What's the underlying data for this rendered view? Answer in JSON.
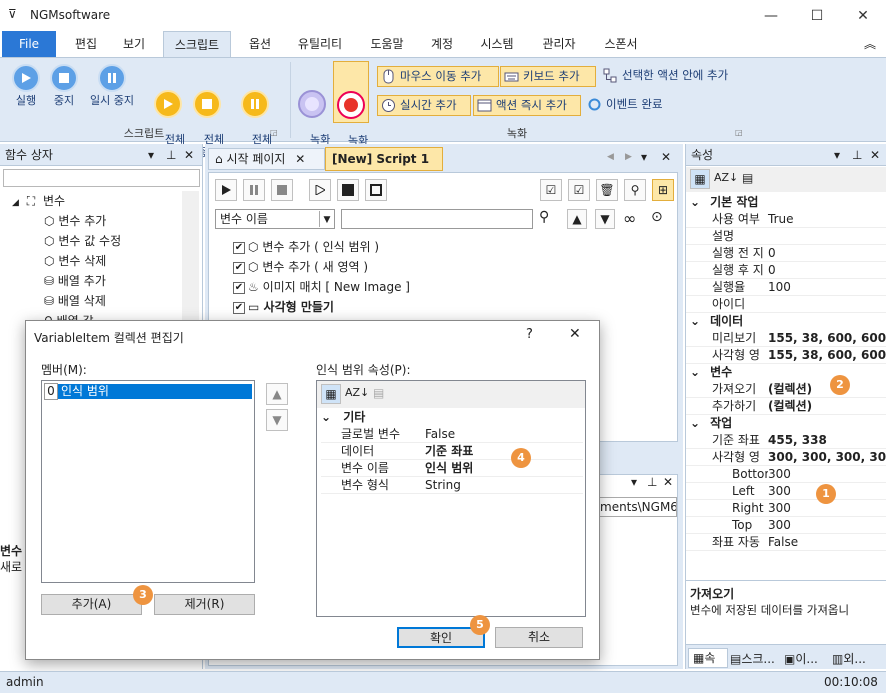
{
  "app": {
    "title": "NGMsoftware",
    "window": {
      "minimize": "—",
      "maximize": "☐",
      "close": "✕"
    }
  },
  "menu": {
    "file": "File",
    "items": [
      "편집",
      "보기",
      "스크립트",
      "옵션",
      "유틸리티",
      "도움말",
      "계정",
      "시스템",
      "관리자",
      "스폰서"
    ],
    "collapse": "︽"
  },
  "ribbon": {
    "script": {
      "run": "실행",
      "stop": "중지",
      "pause": "일시 중지",
      "all_run": "전체\n실행",
      "all_stop": "전체\n중지",
      "all_pause": "전체\n일시 중지",
      "group": "스크립트"
    },
    "record": {
      "start": "녹화\n시작",
      "stop": "녹화\n중지",
      "mouse_move": "마우스 이동 추가",
      "keyboard": "키보드 추가",
      "in_action": "선택한 액션 안에 추가",
      "realtime": "실시간 추가",
      "action_now": "액션 즉시 추가",
      "event_done": "이벤트 완료",
      "group": "녹화"
    }
  },
  "left_panel": {
    "title": "함수 상자",
    "tree_root": "변수",
    "items": [
      "변수 추가",
      "변수 값 수정",
      "변수 삭제",
      "배열 추가",
      "배열 삭제",
      "배열 값"
    ],
    "bottom_title": "변수",
    "bottom_text": "새로"
  },
  "tabs": {
    "start_page": "시작 페이지",
    "script": "[New] Script 1"
  },
  "editor": {
    "var_select": "변수 이름",
    "actions": [
      {
        "label": "변수 추가 ( 인식 범위 )",
        "bold": false
      },
      {
        "label": "변수 추가 ( 새 영역 )",
        "bold": false
      },
      {
        "label": "이미지 매치 [ New Image ]",
        "bold": false
      },
      {
        "label": "사각형 만들기",
        "bold": true
      }
    ],
    "path_fragment": "ments\\NGM6\\"
  },
  "properties": {
    "title": "속성",
    "sections": [
      {
        "name": "기본 작업",
        "rows": [
          [
            "사용 여부",
            "True"
          ],
          [
            "설명",
            ""
          ],
          [
            "실행 전 지",
            "0"
          ],
          [
            "실행 후 지",
            "0"
          ],
          [
            "실행율",
            "100"
          ],
          [
            "아이디",
            ""
          ]
        ]
      },
      {
        "name": "데이터",
        "rows": [
          [
            "미리보기",
            "155, 38, 600, 600"
          ],
          [
            "사각형 영",
            "155, 38, 600, 600"
          ]
        ]
      },
      {
        "name": "변수",
        "rows": [
          [
            "가져오기",
            "(컬렉션)"
          ],
          [
            "추가하기",
            "(컬렉션)"
          ]
        ]
      },
      {
        "name": "작업",
        "rows": [
          [
            "기준 좌표",
            "455, 338"
          ],
          [
            "사각형 영",
            "300, 300, 300, 300"
          ],
          [
            "Bottom",
            "300"
          ],
          [
            "Left",
            "300"
          ],
          [
            "Right",
            "300"
          ],
          [
            "Top",
            "300"
          ],
          [
            "좌표 자동",
            "False"
          ]
        ]
      }
    ],
    "desc_title": "가져오기",
    "desc_text": "변수에 저장된 데이터를 가져옵니",
    "bottom_tabs": [
      "속",
      "스크...",
      "이...",
      "외..."
    ]
  },
  "dialog": {
    "title": "VariableItem 컬렉션 편집기",
    "help": "?",
    "close": "✕",
    "members_label": "멤버(M):",
    "member_index": "0",
    "member_name": "인식 범위",
    "props_label": "인식 범위 속성(P):",
    "section": "기타",
    "rows": [
      [
        "글로벌 변수",
        "False",
        false
      ],
      [
        "데이터",
        "기준 좌표",
        true
      ],
      [
        "변수 이름",
        "인식 범위",
        true
      ],
      [
        "변수 형식",
        "String",
        false
      ]
    ],
    "add": "추가(A)",
    "remove": "제거(R)",
    "ok": "확인",
    "cancel": "취소"
  },
  "badges": [
    "1",
    "2",
    "3",
    "4",
    "5"
  ],
  "status": {
    "user": "admin",
    "time": "00:10:08"
  }
}
